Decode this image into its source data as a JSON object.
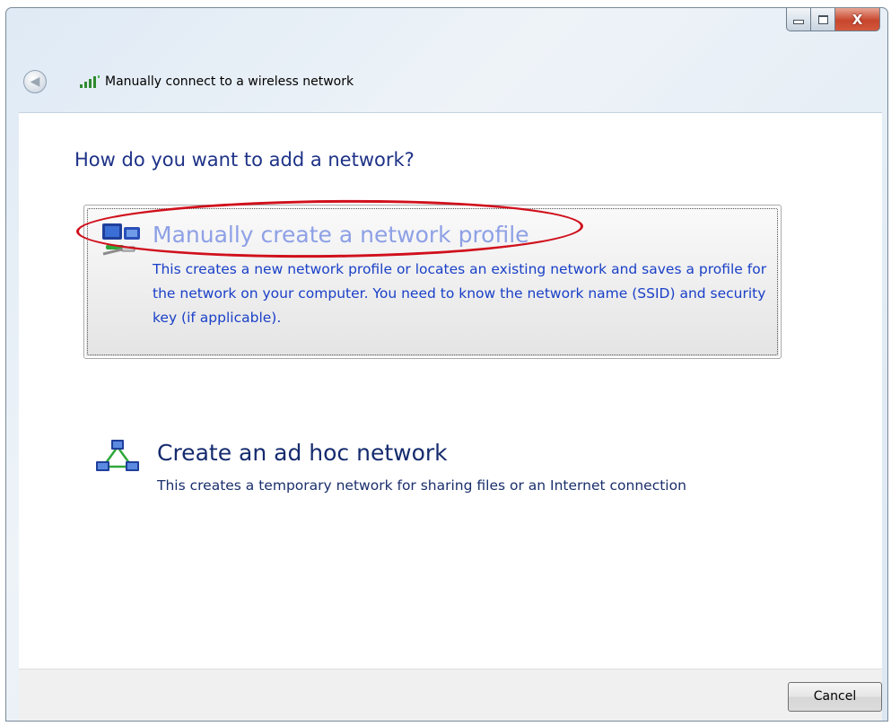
{
  "window": {
    "title": "Manually connect to a wireless network",
    "caption_buttons": {
      "minimize_icon": "minimize-icon",
      "maximize_icon": "maximize-icon",
      "close_glyph": "X"
    }
  },
  "main": {
    "heading": "How do you want to add a network?",
    "options": [
      {
        "title": "Manually create a network profile",
        "description": "This creates a new network profile or locates an existing network and saves a profile for the network on your computer. You need to know the network name (SSID) and security key (if applicable).",
        "icon": "network-profile-icon",
        "state": "hover"
      },
      {
        "title": "Create an ad hoc network",
        "description": "This creates a temporary network for sharing files or an Internet connection",
        "icon": "ad-hoc-network-icon",
        "state": "normal"
      }
    ]
  },
  "footer": {
    "cancel_label": "Cancel"
  },
  "annotation": {
    "type": "red ellipse highlight",
    "target": "Manually create a network profile",
    "color": "#d0101c"
  }
}
